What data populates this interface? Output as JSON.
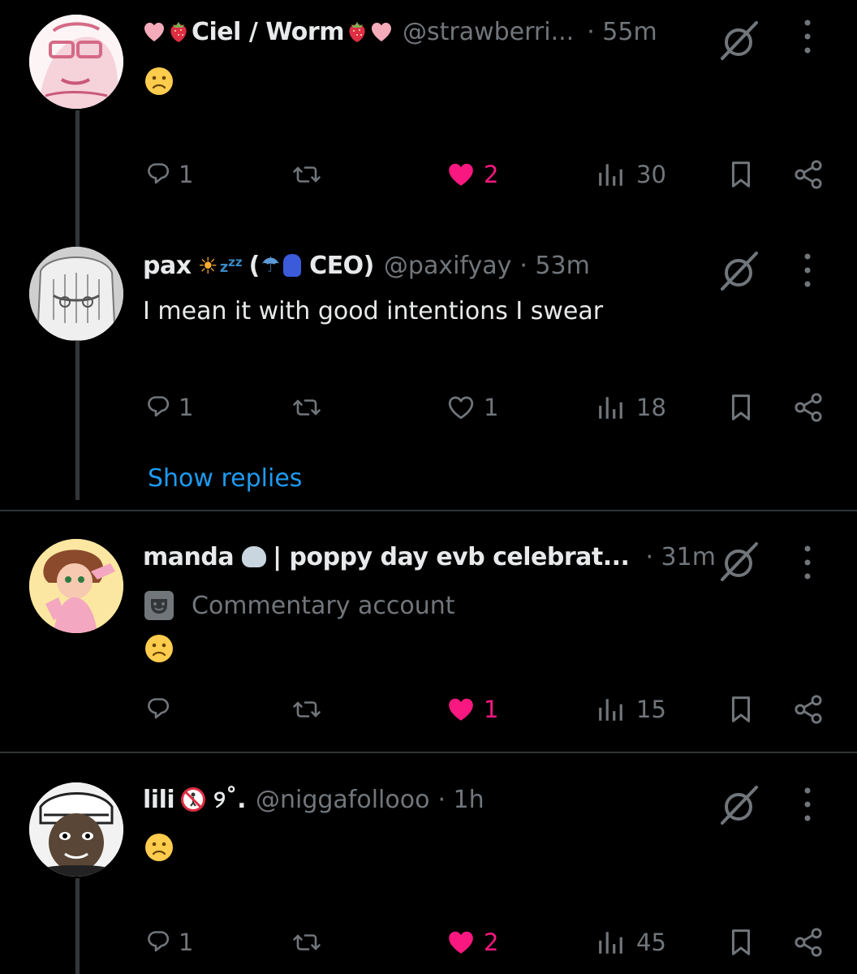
{
  "colors": {
    "background": "#000000",
    "text": "#e7e9ea",
    "muted": "#71767b",
    "like": "#f91880",
    "link": "#1d9bf0",
    "divider": "#2f3336"
  },
  "posts": [
    {
      "name": "Ciel / Worm",
      "name_prefix_emojis": [
        "pink-heart",
        "strawberry"
      ],
      "name_suffix_emojis": [
        "strawberry",
        "pink-heart"
      ],
      "handle": "@strawberri...",
      "time": "· 55m",
      "text": "",
      "emoji": "frowning-face",
      "actions": {
        "reply": "1",
        "repost": "",
        "like": "2",
        "liked": true,
        "views": "30"
      }
    },
    {
      "name_start": "pax",
      "name_emojis": [
        "sun",
        "zzz",
        "umbrella",
        "hamsa"
      ],
      "name_paren_open": "(",
      "name_end": "CEO)",
      "handle": "@paxifyay",
      "time": "· 53m",
      "text": "I mean it with good intentions I swear",
      "actions": {
        "reply": "1",
        "repost": "",
        "like": "1",
        "liked": false,
        "views": "18"
      }
    },
    {
      "name_start": "manda",
      "name_emojis": [
        "seal"
      ],
      "name_end": "| poppy day evb celebrat...",
      "handle": "",
      "time": "· 31m",
      "badge": "Commentary account",
      "badge_icon": "theater-masks",
      "emoji": "frowning-face",
      "actions": {
        "reply": "",
        "repost": "",
        "like": "1",
        "liked": true,
        "views": "15"
      }
    },
    {
      "name_start": "lili",
      "name_emojis": [
        "no-pedestrians"
      ],
      "name_end": "୨˚.",
      "handle": "@niggafollooo",
      "time": "· 1h",
      "text": "",
      "emoji": "slightly-frowning-face",
      "actions": {
        "reply": "1",
        "repost": "",
        "like": "2",
        "liked": true,
        "views": "45"
      }
    }
  ],
  "show_replies": "Show replies"
}
